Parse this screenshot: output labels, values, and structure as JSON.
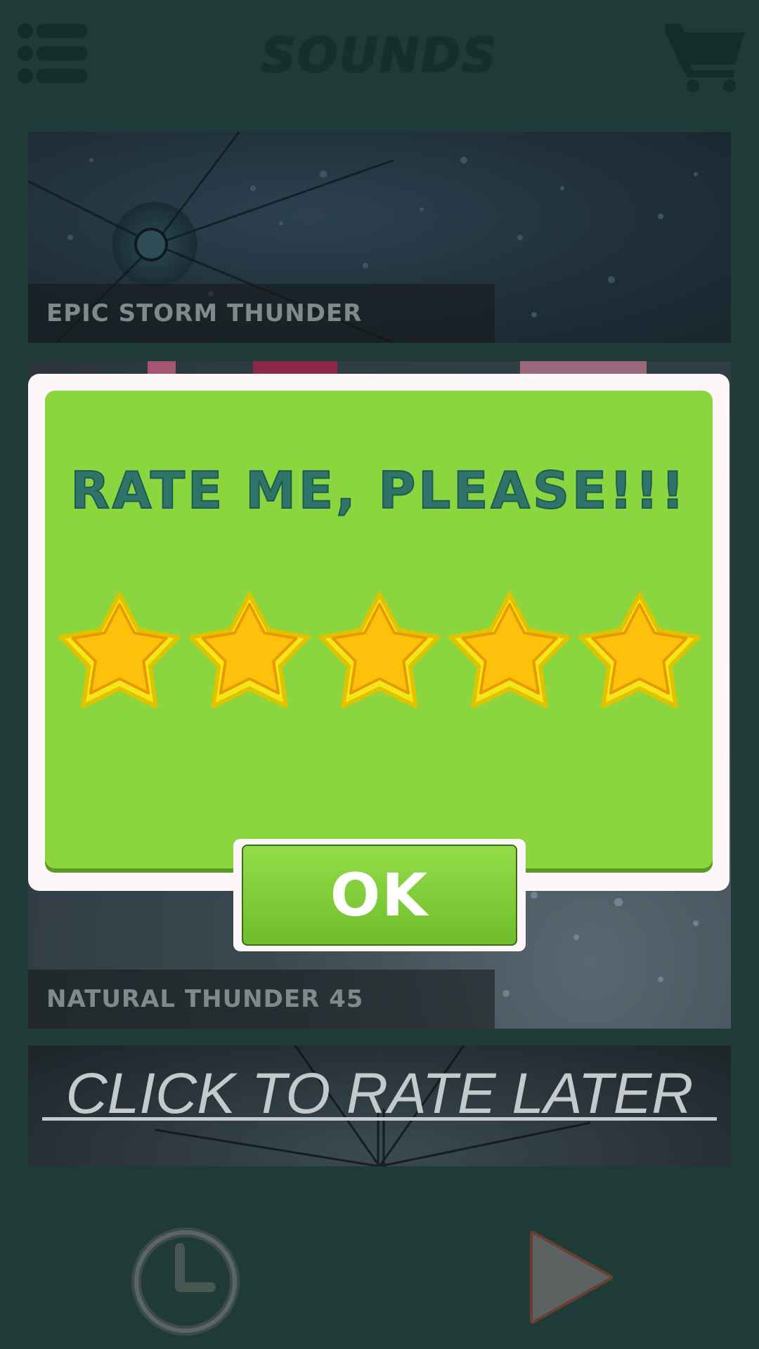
{
  "header": {
    "title": "SOUNDS",
    "menu_icon": "menu-list-icon",
    "cart_icon": "shopping-cart-icon"
  },
  "sounds": [
    {
      "label": "EPIC STORM THUNDER"
    },
    {
      "label": "NATURAL THUNDER 45"
    }
  ],
  "rate_later": {
    "label": "CLICK TO RATE LATER"
  },
  "dialog": {
    "title": "RATE ME, PLEASE!!!",
    "rating": {
      "value": 5,
      "max": 5
    },
    "ok_label": "OK"
  },
  "controls": {
    "timer_icon": "clock-icon",
    "play_icon": "play-icon"
  },
  "colors": {
    "background": "#1e3b37",
    "dialog_green": "#8bd63f",
    "title_teal": "#2e7468",
    "star_gold": "#fcc10a"
  }
}
